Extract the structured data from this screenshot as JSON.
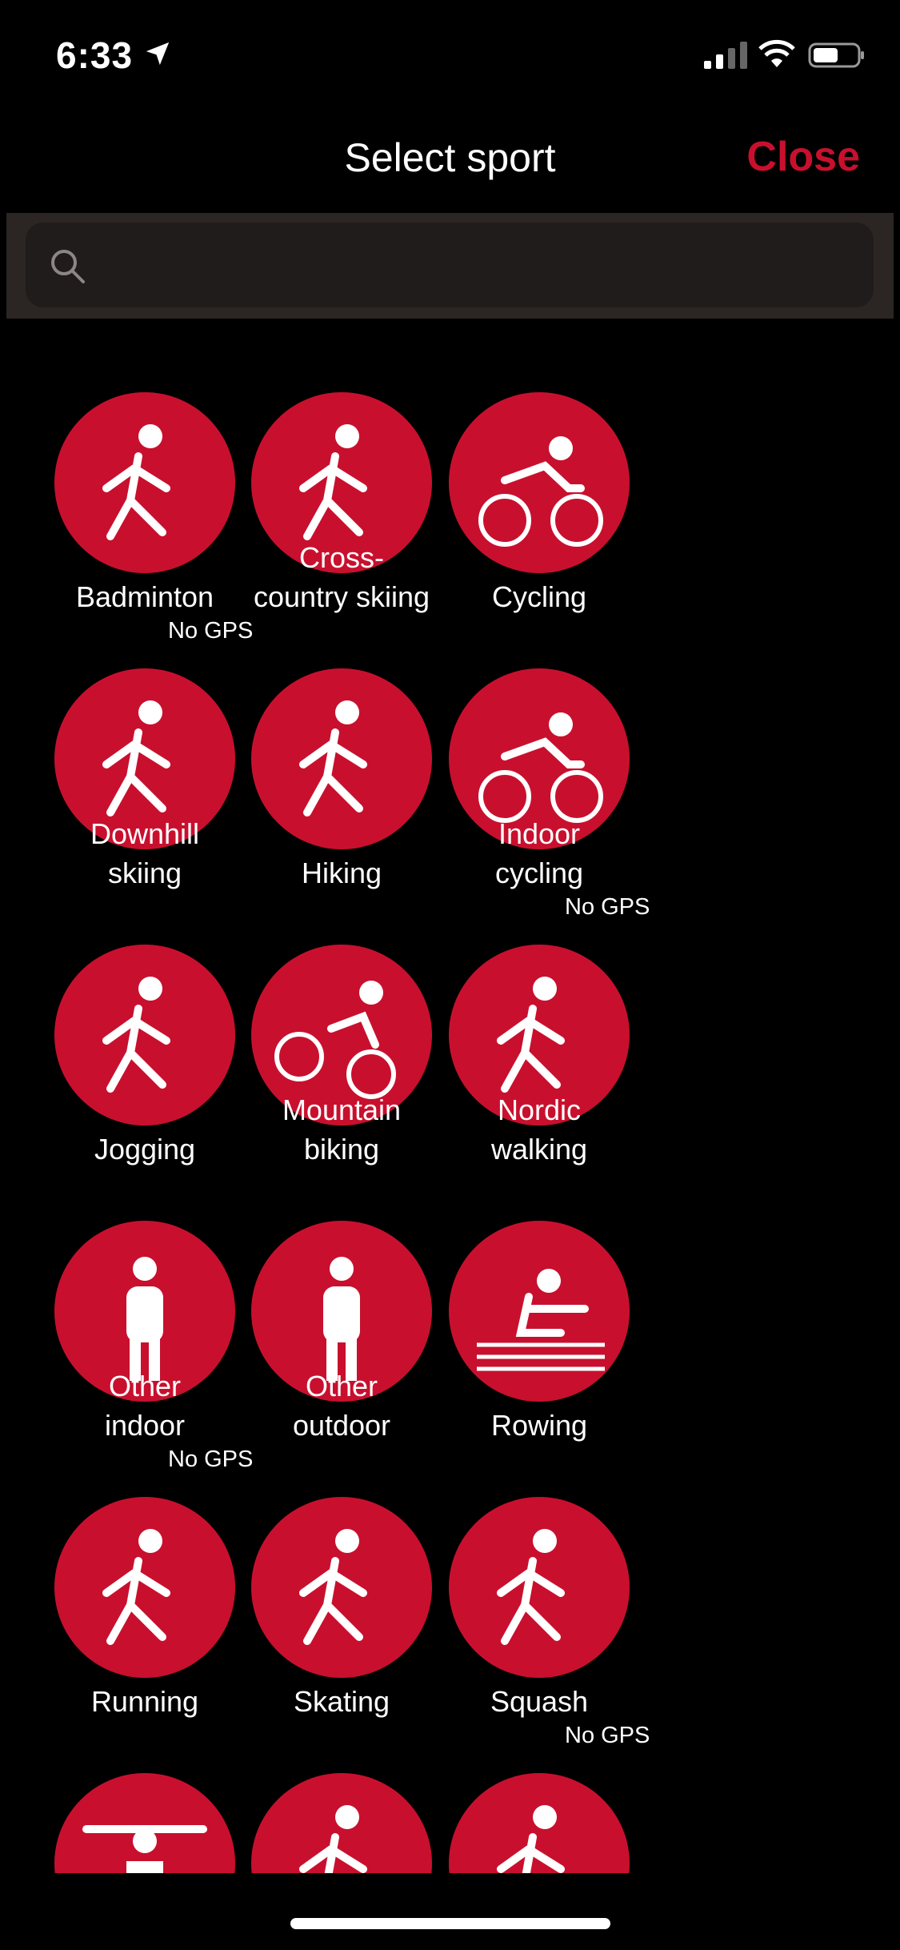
{
  "status_bar": {
    "time": "6:33"
  },
  "header": {
    "title": "Select sport",
    "close_label": "Close"
  },
  "search": {
    "placeholder": "",
    "value": ""
  },
  "sports": [
    {
      "label": "Badminton",
      "note": "No GPS",
      "icon": "badminton-icon"
    },
    {
      "label": "Cross-\ncountry skiing",
      "note": "",
      "icon": "cross-country-skiing-icon"
    },
    {
      "label": "Cycling",
      "note": "",
      "icon": "cycling-icon"
    },
    {
      "label": "Downhill\nskiing",
      "note": "",
      "icon": "downhill-skiing-icon"
    },
    {
      "label": "Hiking",
      "note": "",
      "icon": "hiking-icon"
    },
    {
      "label": "Indoor\ncycling",
      "note": "No GPS",
      "icon": "indoor-cycling-icon"
    },
    {
      "label": "Jogging",
      "note": "",
      "icon": "jogging-icon"
    },
    {
      "label": "Mountain\nbiking",
      "note": "",
      "icon": "mountain-biking-icon"
    },
    {
      "label": "Nordic\nwalking",
      "note": "",
      "icon": "nordic-walking-icon"
    },
    {
      "label": "Other\nindoor",
      "note": "No GPS",
      "icon": "other-indoor-icon"
    },
    {
      "label": "Other\noutdoor",
      "note": "",
      "icon": "other-outdoor-icon"
    },
    {
      "label": "Rowing",
      "note": "",
      "icon": "rowing-icon"
    },
    {
      "label": "Running",
      "note": "",
      "icon": "running-icon"
    },
    {
      "label": "Skating",
      "note": "",
      "icon": "skating-icon"
    },
    {
      "label": "Squash",
      "note": "No GPS",
      "icon": "squash-icon"
    },
    {
      "label": "",
      "note": "",
      "icon": "strength-training-icon"
    },
    {
      "label": "",
      "note": "",
      "icon": "tennis-icon"
    },
    {
      "label": "",
      "note": "",
      "icon": "sport-icon"
    }
  ],
  "colors": {
    "accent": "#c8102e",
    "background": "#000000",
    "search_bar": "#2b2623"
  }
}
